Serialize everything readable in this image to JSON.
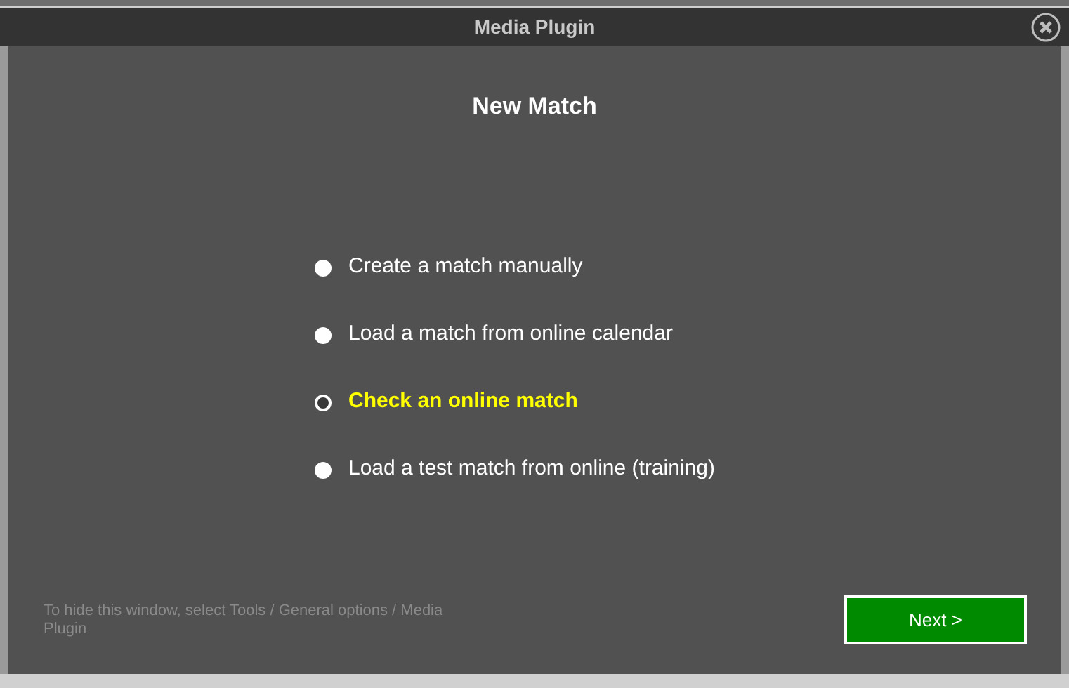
{
  "window": {
    "title": "Media Plugin"
  },
  "heading": "New Match",
  "options": [
    {
      "label": "Create a match manually",
      "selected": false
    },
    {
      "label": "Load a match from online calendar",
      "selected": false
    },
    {
      "label": "Check an online match",
      "selected": true
    },
    {
      "label": "Load a test match from online (training)",
      "selected": false
    }
  ],
  "hint": "To hide this window, select Tools / General options / Media Plugin",
  "buttons": [
    "Next >"
  ]
}
